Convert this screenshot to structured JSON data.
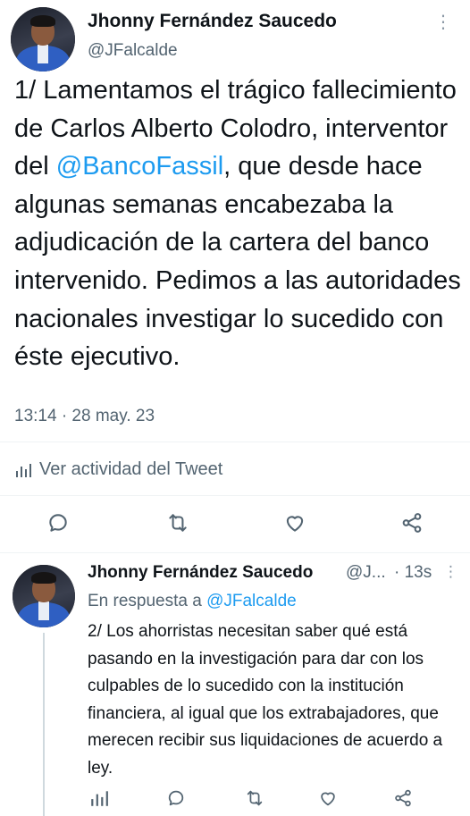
{
  "tweet": {
    "author_name": "Jhonny Fernández Saucedo",
    "handle": "@JFalcalde",
    "text_before_mention": "1/ Lamentamos el trágico fallecimiento de Carlos Alberto Colodro, interventor del ",
    "mention": "@BancoFassil",
    "text_after_mention": ", que desde hace algunas semanas encabezaba la adjudicación de la cartera del banco intervenido. Pedimos a las autoridades nacionales investigar lo sucedido con éste ejecutivo.",
    "timestamp": "13:14 · 28 may. 23",
    "activity_label": "Ver actividad del Tweet",
    "actions": [
      "reply-icon",
      "retweet-icon",
      "like-icon",
      "share-icon"
    ]
  },
  "reply": {
    "author_name": "Jhonny Fernández Saucedo",
    "handle_truncated": "@J...",
    "time": "· 13s",
    "reply_prefix": "En respuesta a ",
    "reply_to": "@JFalcalde",
    "text": "2/ Los ahorristas necesitan saber qué está pasando en la investigación para dar con los culpables de lo sucedido con la institución financiera, al igual que los extrabajadores, que merecen recibir sus liquidaciones de acuerdo a ley.",
    "actions": [
      "analytics-icon",
      "reply-icon",
      "retweet-icon",
      "like-icon",
      "share-icon"
    ]
  },
  "colors": {
    "text": "#0f1419",
    "secondary": "#536471",
    "link": "#1d9bf0",
    "divider": "#eff3f4"
  }
}
